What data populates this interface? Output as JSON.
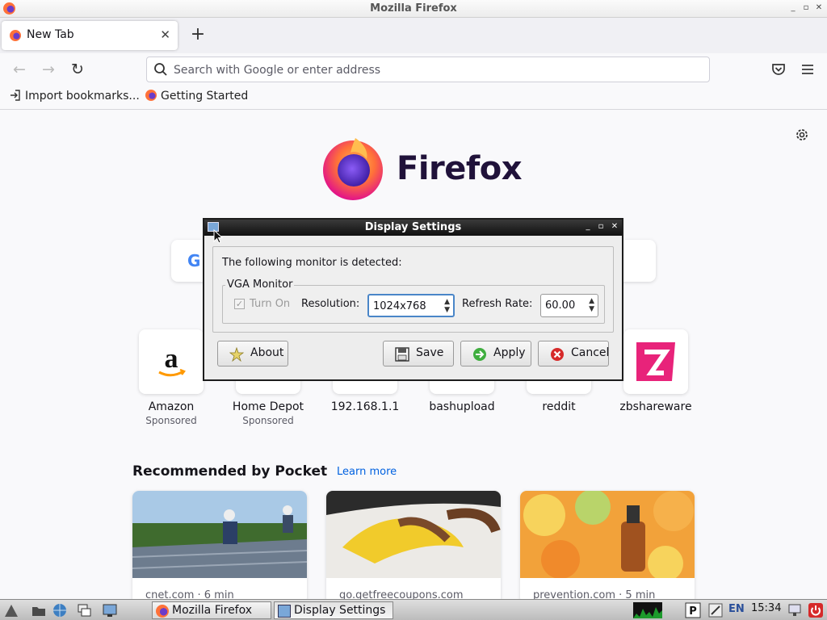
{
  "window": {
    "title": "Mozilla Firefox",
    "controls": [
      "minimize",
      "maximize",
      "close"
    ]
  },
  "tabs": [
    {
      "label": "New Tab",
      "active": true
    }
  ],
  "toolbar": {
    "url_placeholder": "Search with Google or enter address"
  },
  "bookmarks": [
    {
      "label": "Import bookmarks...",
      "icon": "import-icon"
    },
    {
      "label": "Getting Started",
      "icon": "firefox-icon"
    }
  ],
  "newtab": {
    "brand": "Firefox",
    "shortcuts": [
      {
        "name": "Amazon",
        "sub": "Sponsored"
      },
      {
        "name": "Home Depot",
        "sub": "Sponsored"
      },
      {
        "name": "192.168.1.1",
        "sub": ""
      },
      {
        "name": "bashupload",
        "sub": ""
      },
      {
        "name": "reddit",
        "sub": ""
      },
      {
        "name": "zbshareware",
        "sub": ""
      }
    ],
    "pocket": {
      "title": "Recommended by Pocket",
      "learn_more": "Learn more",
      "cards": [
        {
          "source": "cnet.com · 6 min"
        },
        {
          "source": "go.getfreecoupons.com"
        },
        {
          "source": "prevention.com · 5 min"
        }
      ]
    }
  },
  "dialog": {
    "title": "Display Settings",
    "detected_text": "The following monitor is detected:",
    "monitor_name": "VGA Monitor",
    "turn_on_label": "Turn On",
    "turn_on_checked": true,
    "resolution_label": "Resolution:",
    "resolution_value": "1024x768",
    "refresh_label": "Refresh Rate:",
    "refresh_value": "60.00",
    "buttons": {
      "about": "About",
      "save": "Save",
      "apply": "Apply",
      "cancel": "Cancel"
    }
  },
  "taskbar": {
    "tasks": [
      {
        "label": "Mozilla Firefox",
        "active": false
      },
      {
        "label": "Display Settings",
        "active": true
      }
    ],
    "language": "EN",
    "clock": "15:34"
  },
  "colors": {
    "accent": "#0061e0",
    "brand_text": "#20123a",
    "dialog_title_bg": "#111111"
  }
}
